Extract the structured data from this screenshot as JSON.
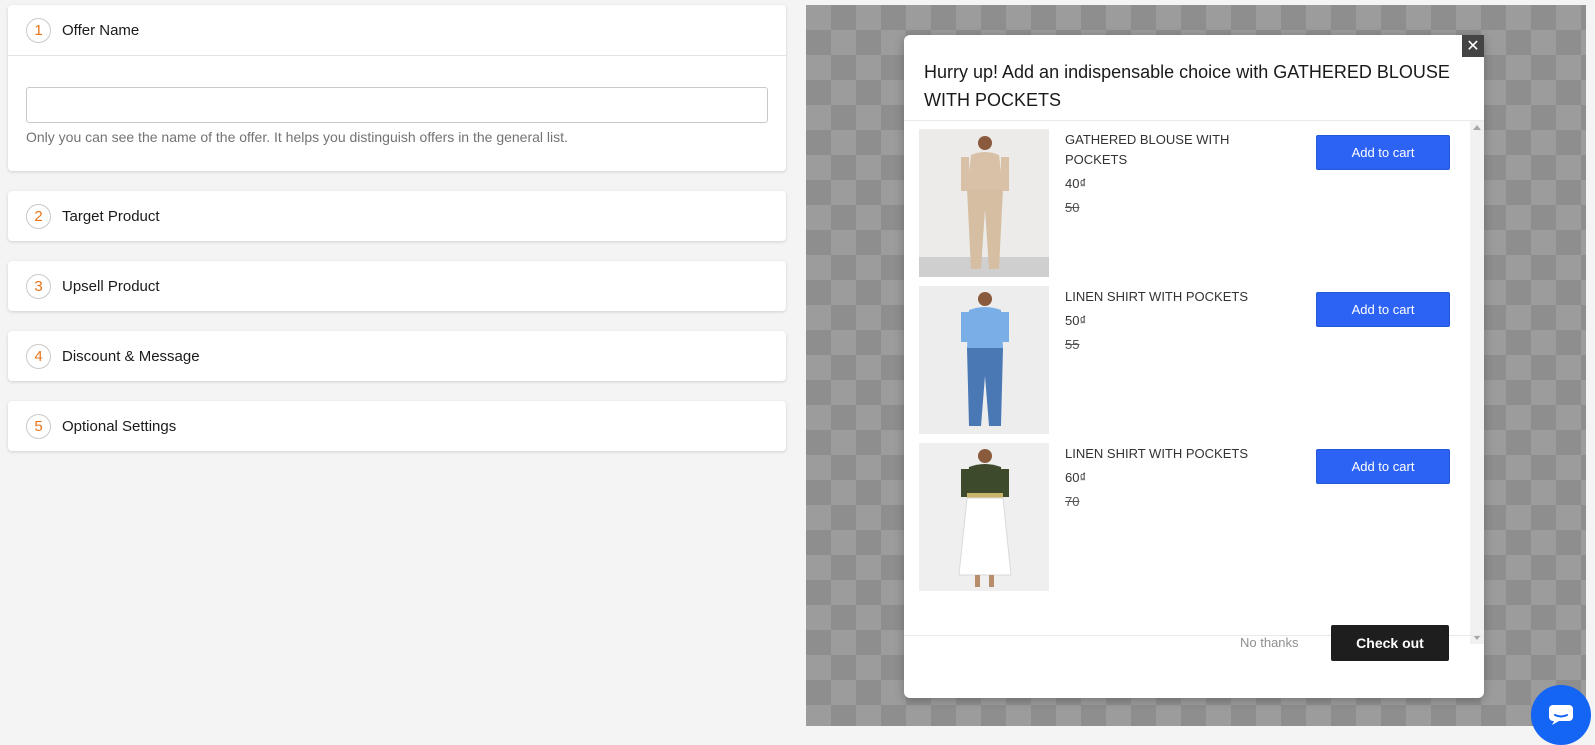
{
  "steps": [
    {
      "number": "1",
      "title": "Offer Name"
    },
    {
      "number": "2",
      "title": "Target Product"
    },
    {
      "number": "3",
      "title": "Upsell Product"
    },
    {
      "number": "4",
      "title": "Discount & Message"
    },
    {
      "number": "5",
      "title": "Optional Settings"
    }
  ],
  "offer_name": {
    "value": "",
    "placeholder": "",
    "helper": "Only you can see the name of the offer. It helps you distinguish offers in the general list."
  },
  "popup": {
    "title": "Hurry up! Add an indispensable choice with GATHERED BLOUSE WITH POCKETS",
    "close_icon": "close-icon",
    "products": [
      {
        "name": "GATHERED BLOUSE WITH POCKETS",
        "price": "40₫",
        "old_price": "50",
        "button": "Add to cart"
      },
      {
        "name": "LINEN SHIRT WITH POCKETS",
        "price": "50₫",
        "old_price": "55",
        "button": "Add to cart"
      },
      {
        "name": "LINEN SHIRT WITH POCKETS",
        "price": "60₫",
        "old_price": "70",
        "button": "Add to cart"
      }
    ],
    "no_thanks": "No thanks",
    "checkout": "Check out"
  },
  "colors": {
    "step_number": "#e8751a",
    "add_to_cart": "#2c63f5",
    "checkout": "#1e1e1e",
    "chat_button": "#1565f5"
  },
  "chat_icon": "chat-icon"
}
